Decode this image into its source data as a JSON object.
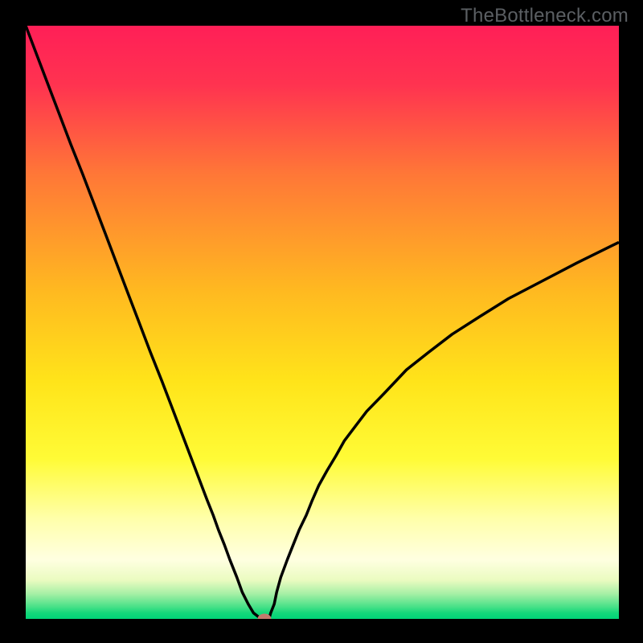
{
  "watermark": {
    "text": "TheBottleneck.com"
  },
  "chart_data": {
    "type": "line",
    "title": "",
    "xlabel": "",
    "ylabel": "",
    "xlim": [
      0,
      100
    ],
    "ylim": [
      0,
      100
    ],
    "background": {
      "type": "vertical-gradient",
      "stops": [
        {
          "pct": 0,
          "color": "#ff1f57"
        },
        {
          "pct": 10,
          "color": "#ff3350"
        },
        {
          "pct": 25,
          "color": "#ff7737"
        },
        {
          "pct": 45,
          "color": "#ffba20"
        },
        {
          "pct": 60,
          "color": "#ffe41a"
        },
        {
          "pct": 73,
          "color": "#fffb36"
        },
        {
          "pct": 83,
          "color": "#ffffa9"
        },
        {
          "pct": 90,
          "color": "#ffffe1"
        },
        {
          "pct": 93.5,
          "color": "#eafbc0"
        },
        {
          "pct": 95.7,
          "color": "#a9f0a6"
        },
        {
          "pct": 97.8,
          "color": "#4fe28a"
        },
        {
          "pct": 99,
          "color": "#14d87a"
        },
        {
          "pct": 100,
          "color": "#00d477"
        }
      ]
    },
    "series": [
      {
        "name": "bottleneck-curve",
        "color": "#000000",
        "width": 3.5,
        "x": [
          0.0,
          1.9,
          3.8,
          5.7,
          7.6,
          9.6,
          11.5,
          13.4,
          15.3,
          17.2,
          19.1,
          21.0,
          23.0,
          24.9,
          26.8,
          28.7,
          30.6,
          31.6,
          32.5,
          33.5,
          34.4,
          35.6,
          36.5,
          37.5,
          38.4,
          39.3,
          40.3,
          41.1,
          41.3,
          41.9,
          42.3,
          43.0,
          44.1,
          45.1,
          46.1,
          47.3,
          48.3,
          49.4,
          50.8,
          52.3,
          53.7,
          55.6,
          57.5,
          60.4,
          64.2,
          68.0,
          71.9,
          76.6,
          81.4,
          86.2,
          92.9,
          100.0
        ],
        "y": [
          100.0,
          95.0,
          90.0,
          85.0,
          80.0,
          75.0,
          70.0,
          65.0,
          60.0,
          55.0,
          50.0,
          45.0,
          40.0,
          35.0,
          30.0,
          25.0,
          20.0,
          17.5,
          15.0,
          12.5,
          10.0,
          7.0,
          4.5,
          2.5,
          1.0,
          0.3,
          0.0,
          0.3,
          1.0,
          2.5,
          4.5,
          7.0,
          10.0,
          12.5,
          15.0,
          17.5,
          20.0,
          22.5,
          25.0,
          27.5,
          30.0,
          32.5,
          35.0,
          38.0,
          42.0,
          45.0,
          48.0,
          51.0,
          54.0,
          56.5,
          60.0,
          63.5
        ]
      }
    ],
    "min_marker": {
      "x": 40.3,
      "y": 0.0,
      "color": "#c27a6d"
    }
  }
}
